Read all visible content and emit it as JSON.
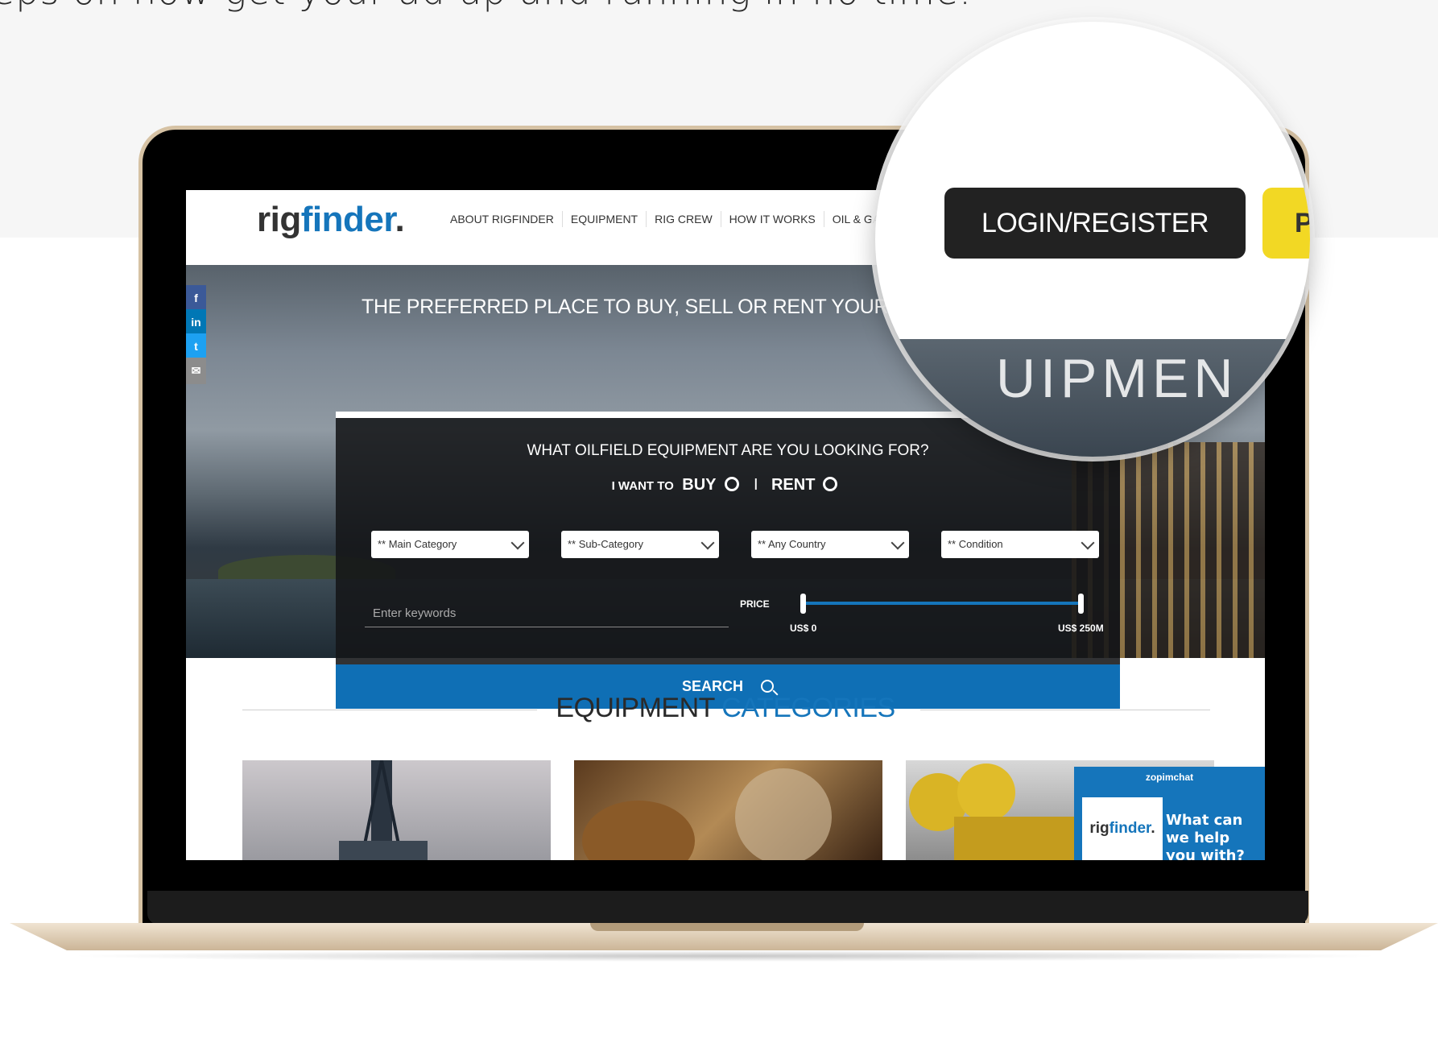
{
  "intro": {
    "text": "eps on how get your ad up and running in no time."
  },
  "site": {
    "logo_pre": "rig",
    "logo_accent": "finder",
    "logo_post": ".",
    "nav": [
      "ABOUT RIGFINDER",
      "EQUIPMENT",
      "RIG CREW",
      "HOW IT WORKS",
      "OIL & GAS NE"
    ],
    "social": [
      {
        "label": "f",
        "icon": "facebook-icon",
        "color": "#3b5998"
      },
      {
        "label": "in",
        "icon": "linkedin-icon",
        "color": "#0077b5"
      },
      {
        "label": "t",
        "icon": "twitter-icon",
        "color": "#1da1f2"
      },
      {
        "label": "✉",
        "icon": "email-icon",
        "color": "#8c8c8c"
      }
    ]
  },
  "hero": {
    "title": "THE PREFERRED PLACE TO BUY, SELL OR RENT YOUR O",
    "question": "WHAT OILFIELD EQUIPMENT ARE YOU LOOKING FOR?",
    "want_label": "I WANT TO",
    "option_buy": "BUY",
    "separator": "I",
    "option_rent": "RENT",
    "selects": [
      "** Main Category",
      "** Sub-Category",
      "** Any Country",
      "** Condition"
    ],
    "keywords_placeholder": "Enter keywords",
    "price_label": "PRICE",
    "price_min": "US$ 0",
    "price_max": "US$ 250M",
    "search_label": "SEARCH"
  },
  "categories": {
    "heading_main": "EQUIPMENT",
    "heading_accent": "CATEGORIES"
  },
  "chat": {
    "brand": "zopimchat",
    "logo_pre": "rig",
    "logo_accent": "finder",
    "logo_post": ".",
    "text": "What can we help you with?"
  },
  "magnifier": {
    "login_label": "LOGIN/REGISTER",
    "post_label": "P",
    "hero_partial": "UIPMEN"
  },
  "colors": {
    "accent": "#1575bb",
    "search_button": "#0f6fb5",
    "post_button": "#f2d824",
    "login_button": "#222222"
  }
}
